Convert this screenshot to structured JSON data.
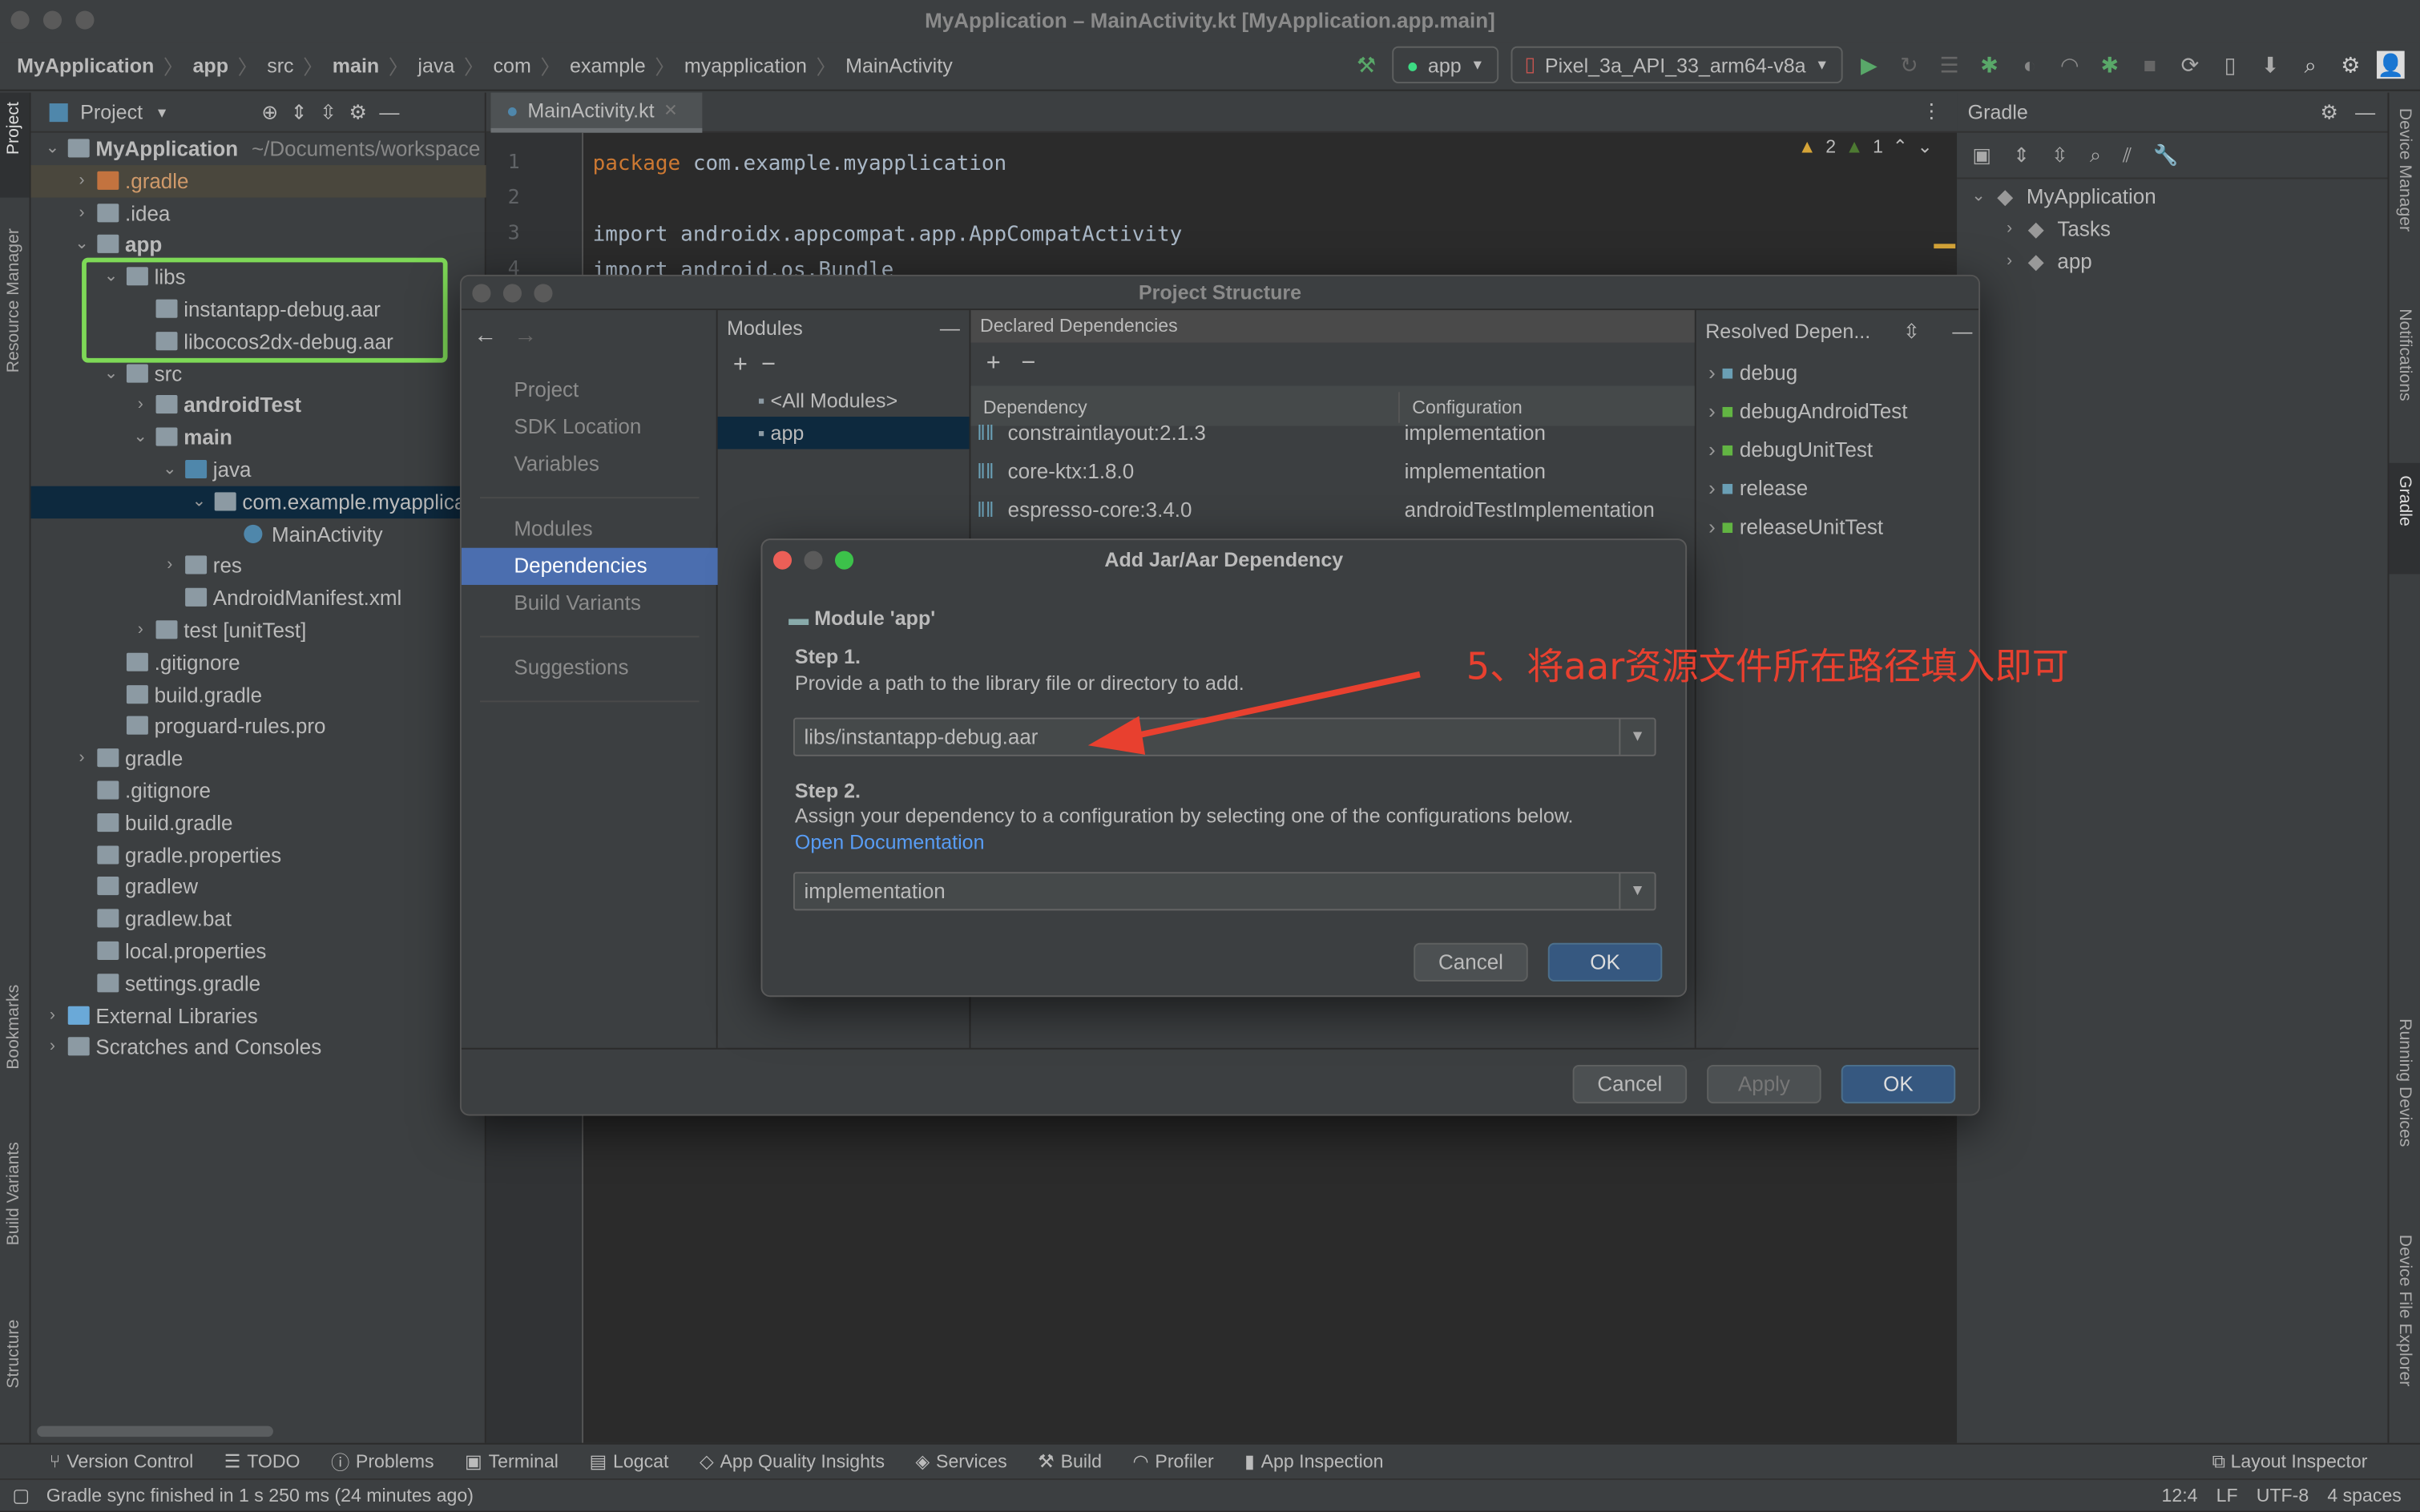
{
  "window": {
    "title": "MyApplication – MainActivity.kt [MyApplication.app.main]"
  },
  "breadcrumb": [
    "MyApplication",
    "app",
    "src",
    "main",
    "java",
    "com",
    "example",
    "myapplication",
    "MainActivity"
  ],
  "toolbar": {
    "config": "app",
    "device": "Pixel_3a_API_33_arm64-v8a"
  },
  "left_stripe": {
    "project": "Project",
    "resource_manager": "Resource Manager",
    "bookmarks": "Bookmarks",
    "build_variants": "Build Variants",
    "structure": "Structure"
  },
  "right_stripe": {
    "device_manager": "Device Manager",
    "notifications": "Notifications",
    "gradle": "Gradle",
    "running_devices": "Running Devices",
    "device_file_explorer": "Device File Explorer"
  },
  "project_panel": {
    "title": "Project",
    "tree": [
      {
        "label": "MyApplication",
        "hint": "~/Documents/workspace",
        "level": 0,
        "bold": true,
        "expanded": true,
        "icon": "module-folder"
      },
      {
        "label": ".gradle",
        "level": 1,
        "icon": "folder-orange",
        "highlight": true
      },
      {
        "label": ".idea",
        "level": 1,
        "icon": "folder"
      },
      {
        "label": "app",
        "level": 1,
        "bold": true,
        "expanded": true,
        "icon": "module-folder"
      },
      {
        "label": "libs",
        "level": 2,
        "expanded": true,
        "icon": "folder"
      },
      {
        "label": "instantapp-debug.aar",
        "level": 3,
        "icon": "aar-file",
        "leaf": true
      },
      {
        "label": "libcocos2dx-debug.aar",
        "level": 3,
        "icon": "aar-file",
        "leaf": true
      },
      {
        "label": "src",
        "level": 2,
        "expanded": true,
        "icon": "folder"
      },
      {
        "label": "androidTest",
        "level": 3,
        "bold": true,
        "icon": "folder"
      },
      {
        "label": "main",
        "level": 3,
        "bold": true,
        "expanded": true,
        "icon": "folder"
      },
      {
        "label": "java",
        "level": 4,
        "expanded": true,
        "icon": "folder-blue"
      },
      {
        "label": "com.example.myapplication",
        "level": 5,
        "expanded": true,
        "icon": "package",
        "selected": true
      },
      {
        "label": "MainActivity",
        "level": 6,
        "icon": "kotlin-class",
        "leaf": true
      },
      {
        "label": "res",
        "level": 4,
        "icon": "folder"
      },
      {
        "label": "AndroidManifest.xml",
        "level": 4,
        "icon": "manifest",
        "leaf": true
      },
      {
        "label": "test [unitTest]",
        "level": 3,
        "icon": "folder"
      },
      {
        "label": ".gitignore",
        "level": 2,
        "icon": "file",
        "leaf": true
      },
      {
        "label": "build.gradle",
        "level": 2,
        "icon": "gradle",
        "leaf": true
      },
      {
        "label": "proguard-rules.pro",
        "level": 2,
        "icon": "file",
        "leaf": true
      },
      {
        "label": "gradle",
        "level": 1,
        "icon": "folder"
      },
      {
        "label": ".gitignore",
        "level": 1,
        "icon": "file",
        "leaf": true
      },
      {
        "label": "build.gradle",
        "level": 1,
        "icon": "gradle",
        "leaf": true
      },
      {
        "label": "gradle.properties",
        "level": 1,
        "icon": "properties",
        "leaf": true
      },
      {
        "label": "gradlew",
        "level": 1,
        "icon": "file",
        "leaf": true
      },
      {
        "label": "gradlew.bat",
        "level": 1,
        "icon": "file",
        "leaf": true
      },
      {
        "label": "local.properties",
        "level": 1,
        "icon": "properties",
        "leaf": true
      },
      {
        "label": "settings.gradle",
        "level": 1,
        "icon": "gradle",
        "leaf": true
      },
      {
        "label": "External Libraries",
        "level": 0,
        "icon": "libraries"
      },
      {
        "label": "Scratches and Consoles",
        "level": 0,
        "icon": "scratches"
      }
    ]
  },
  "editor": {
    "tab": "MainActivity.kt",
    "warnings": "2",
    "weak_warnings": "1",
    "lines": [
      {
        "n": "1",
        "kw": "package",
        "text": " com.example.myapplication"
      },
      {
        "n": "2",
        "kw": "",
        "text": ""
      },
      {
        "n": "3",
        "kw": "",
        "text": "import androidx.appcompat.app.AppCompatActivity"
      },
      {
        "n": "4",
        "kw": "",
        "text": "import android.os.Bundle"
      }
    ]
  },
  "gradle_panel": {
    "title": "Gradle",
    "tree": [
      {
        "label": "MyApplication",
        "level": 0
      },
      {
        "label": "Tasks",
        "level": 1
      },
      {
        "label": "app",
        "level": 1
      }
    ]
  },
  "project_structure": {
    "title": "Project Structure",
    "nav": {
      "group1": [
        "Project",
        "SDK Location",
        "Variables"
      ],
      "group2": [
        "Modules",
        "Dependencies",
        "Build Variants"
      ],
      "group3": [
        "Suggestions"
      ],
      "selected": "Dependencies"
    },
    "modules": {
      "header": "Modules",
      "items": [
        "<All Modules>",
        "app"
      ],
      "selected": "app"
    },
    "declared": {
      "header": "Declared Dependencies",
      "col_dependency": "Dependency",
      "col_configuration": "Configuration",
      "rows": [
        {
          "dep": "constraintlayout:2.1.3",
          "conf": "implementation"
        },
        {
          "dep": "core-ktx:1.8.0",
          "conf": "implementation"
        },
        {
          "dep": "espresso-core:3.4.0",
          "conf": "androidTestImplementation"
        }
      ]
    },
    "resolved": {
      "header": "Resolved Depen...",
      "items": [
        "debug",
        "debugAndroidTest",
        "debugUnitTest",
        "release",
        "releaseUnitTest"
      ]
    },
    "buttons": {
      "cancel": "Cancel",
      "apply": "Apply",
      "ok": "OK"
    }
  },
  "add_dependency": {
    "title": "Add Jar/Aar Dependency",
    "module": "Module 'app'",
    "step1_title": "Step 1.",
    "step1_desc": "Provide a path to the library file or directory to add.",
    "path_value": "libs/instantapp-debug.aar",
    "step2_title": "Step 2.",
    "step2_desc": "Assign your dependency to a configuration by selecting one of the configurations below.",
    "doc_link": "Open Documentation",
    "configuration_value": "implementation",
    "cancel": "Cancel",
    "ok": "OK"
  },
  "annotation": {
    "text": "5、将aar资源文件所在路径填入即可",
    "color": "#e8402f",
    "highlight_color": "#7ed957"
  },
  "bottom_tools": [
    "Version Control",
    "TODO",
    "Problems",
    "Terminal",
    "Logcat",
    "App Quality Insights",
    "Services",
    "Build",
    "Profiler",
    "App Inspection"
  ],
  "layout_inspector": "Layout Inspector",
  "status": {
    "message": "Gradle sync finished in 1 s 250 ms (24 minutes ago)",
    "position": "12:4",
    "line_sep": "LF",
    "encoding": "UTF-8",
    "indent": "4 spaces"
  }
}
